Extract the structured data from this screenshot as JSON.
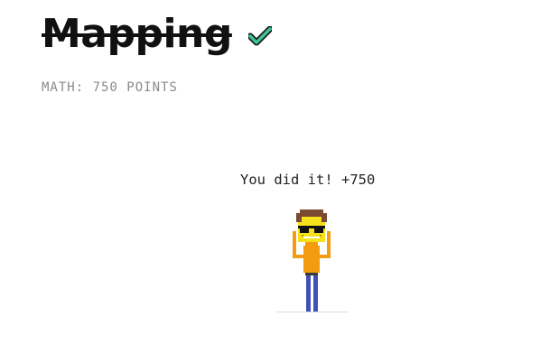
{
  "lesson": {
    "title": "Mapping",
    "completed_icon": "checkmark-icon",
    "subtitle": "MATH: 750 POINTS"
  },
  "result": {
    "message": "You did it! +750",
    "avatar_icon": "pixel-character-icon"
  },
  "colors": {
    "check_fill": "#3cc49a",
    "check_outline": "#1a1a1a",
    "hair": "#7a4a32",
    "skin": "#f5e01c",
    "shirt": "#f39c12",
    "pants": "#3f51b5",
    "glasses": "#111111"
  }
}
